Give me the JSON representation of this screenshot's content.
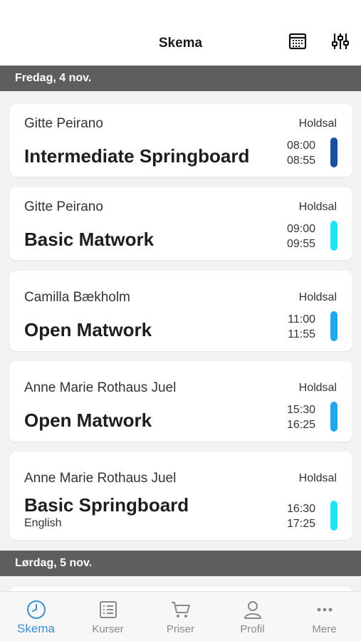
{
  "header": {
    "title": "Skema",
    "calendar_icon": "calendar-icon",
    "filter_icon": "sliders-icon"
  },
  "days": [
    {
      "label": "Fredag, 4 nov.",
      "classes": [
        {
          "instructor": "Gitte  Peirano",
          "room": "Holdsal",
          "title": "Intermediate Springboard",
          "subtitle": "",
          "start": "08:00",
          "end": "08:55",
          "color": "#1a4fa0"
        },
        {
          "instructor": "Gitte  Peirano",
          "room": "Holdsal",
          "title": "Basic Matwork",
          "subtitle": "",
          "start": "09:00",
          "end": "09:55",
          "color": "#1fe3f5"
        },
        {
          "instructor": "Camilla Bækholm",
          "room": "Holdsal",
          "title": "Open Matwork",
          "subtitle": "",
          "start": "11:00",
          "end": "11:55",
          "color": "#22a6ee"
        },
        {
          "instructor": "Anne Marie Rothaus Juel",
          "room": "Holdsal",
          "title": "Open Matwork",
          "subtitle": "",
          "start": "15:30",
          "end": "16:25",
          "color": "#22a6ee"
        },
        {
          "instructor": "Anne Marie Rothaus Juel",
          "room": "Holdsal",
          "title": "Basic Springboard",
          "subtitle": "English",
          "start": "16:30",
          "end": "17:25",
          "color": "#1fe3f5"
        }
      ]
    },
    {
      "label": "Lørdag, 5 nov.",
      "classes": []
    }
  ],
  "tabs": [
    {
      "label": "Skema",
      "icon": "clock-icon",
      "active": true
    },
    {
      "label": "Kurser",
      "icon": "list-icon",
      "active": false
    },
    {
      "label": "Priser",
      "icon": "cart-icon",
      "active": false
    },
    {
      "label": "Profil",
      "icon": "person-icon",
      "active": false
    },
    {
      "label": "Mere",
      "icon": "more-icon",
      "active": false
    }
  ],
  "colors": {
    "active_tab": "#3a8fd0",
    "inactive_tab": "#8a8a8a",
    "day_bar": "#5e5e5e"
  }
}
